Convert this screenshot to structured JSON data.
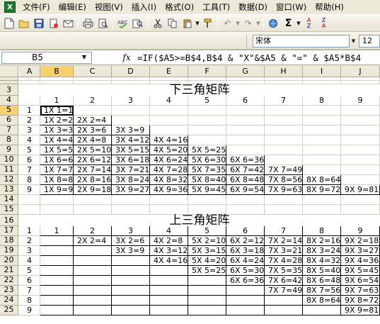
{
  "menubar": {
    "items": [
      "文件(F)",
      "编辑(E)",
      "视图(V)",
      "插入(I)",
      "格式(O)",
      "工具(T)",
      "数据(D)",
      "窗口(W)",
      "帮助(H)"
    ]
  },
  "toolbar": {
    "icons": [
      "new-icon",
      "open-icon",
      "save-icon",
      "permission-icon",
      "email-icon",
      "print-icon",
      "print-preview-icon",
      "spelling-icon",
      "research-icon",
      "cut-icon",
      "copy-icon",
      "paste-icon",
      "format-painter-icon",
      "undo-icon",
      "redo-icon",
      "hyperlink-icon",
      "autosum-icon",
      "sort-ascending-icon",
      "sort-descending-icon"
    ]
  },
  "formatbar": {
    "font": "宋体",
    "size": "12"
  },
  "formulabar": {
    "name_box": "B5",
    "fx": "fx",
    "formula": "=IF($A5>=B$4,B$4 & \"X\"&$A5 & \"=\" & $A5*B$4"
  },
  "columns": [
    "A",
    "B",
    "C",
    "D",
    "E",
    "F",
    "G",
    "H",
    "I",
    "J"
  ],
  "active_cell": {
    "column": "B",
    "row": "5"
  },
  "sheet": {
    "title_lower": "下三角矩阵",
    "title_upper": "上三角矩阵",
    "header_numbers": [
      "1",
      "2",
      "3",
      "4",
      "5",
      "6",
      "7",
      "8",
      "9"
    ],
    "lower_rows": [
      [
        "1",
        "1X 1=1",
        "",
        "",
        "",
        "",
        "",
        "",
        "",
        ""
      ],
      [
        "2",
        "1X 2=2",
        "2X 2=4",
        "",
        "",
        "",
        "",
        "",
        "",
        ""
      ],
      [
        "3",
        "1X 3=3",
        "2X 3=6",
        "3X 3=9",
        "",
        "",
        "",
        "",
        "",
        ""
      ],
      [
        "4",
        "1X 4=4",
        "2X 4=8",
        "3X 4=12",
        "4X 4=16",
        "",
        "",
        "",
        "",
        ""
      ],
      [
        "5",
        "1X 5=5",
        "2X 5=10",
        "3X 5=15",
        "4X 5=20",
        "5X 5=25",
        "",
        "",
        "",
        ""
      ],
      [
        "6",
        "1X 6=6",
        "2X 6=12",
        "3X 6=18",
        "4X 6=24",
        "5X 6=30",
        "6X 6=36",
        "",
        "",
        ""
      ],
      [
        "7",
        "1X 7=7",
        "2X 7=14",
        "3X 7=21",
        "4X 7=28",
        "5X 7=35",
        "6X 7=42",
        "7X 7=49",
        "",
        ""
      ],
      [
        "8",
        "1X 8=8",
        "2X 8=16",
        "3X 8=24",
        "4X 8=32",
        "5X 8=40",
        "6X 8=48",
        "7X 8=56",
        "8X 8=64",
        ""
      ],
      [
        "9",
        "1X 9=9",
        "2X 9=18",
        "3X 9=27",
        "4X 9=36",
        "5X 9=45",
        "6X 9=54",
        "7X 9=63",
        "8X 9=72",
        "9X 9=81"
      ]
    ],
    "upper_rows": [
      [
        "1",
        "1X 1=1",
        "2X 1=2",
        "3X 1=3",
        "4X 1=4",
        "5X 1=5",
        "6X 1=6",
        "7X 1=7",
        "8X 1=8",
        "9X 1=9"
      ],
      [
        "2",
        "",
        "2X 2=4",
        "3X 2=6",
        "4X 2=8",
        "5X 2=10",
        "6X 2=12",
        "7X 2=14",
        "8X 2=16",
        "9X 2=18"
      ],
      [
        "3",
        "",
        "",
        "3X 3=9",
        "4X 3=12",
        "5X 3=15",
        "6X 3=18",
        "7X 3=21",
        "8X 3=24",
        "9X 3=27"
      ],
      [
        "4",
        "",
        "",
        "",
        "4X 4=16",
        "5X 4=20",
        "6X 4=24",
        "7X 4=28",
        "8X 4=32",
        "9X 4=36"
      ],
      [
        "5",
        "",
        "",
        "",
        "",
        "5X 5=25",
        "6X 5=30",
        "7X 5=35",
        "8X 5=40",
        "9X 5=45"
      ],
      [
        "6",
        "",
        "",
        "",
        "",
        "",
        "6X 6=36",
        "7X 6=42",
        "8X 6=48",
        "9X 6=54"
      ],
      [
        "7",
        "",
        "",
        "",
        "",
        "",
        "",
        "7X 7=49",
        "8X 7=56",
        "9X 7=63"
      ],
      [
        "8",
        "",
        "",
        "",
        "",
        "",
        "",
        "",
        "8X 8=64",
        "9X 8=72"
      ],
      [
        "9",
        "",
        "",
        "",
        "",
        "",
        "",
        "",
        "",
        "9X 9=81"
      ]
    ],
    "row_numbers": [
      "1",
      "2",
      "3",
      "4",
      "5",
      "6",
      "7",
      "8",
      "9",
      "10",
      "11",
      "12",
      "13",
      "14",
      "15",
      "16",
      "17",
      "18",
      "19",
      "20",
      "21",
      "22",
      "23",
      "24",
      "25"
    ]
  }
}
